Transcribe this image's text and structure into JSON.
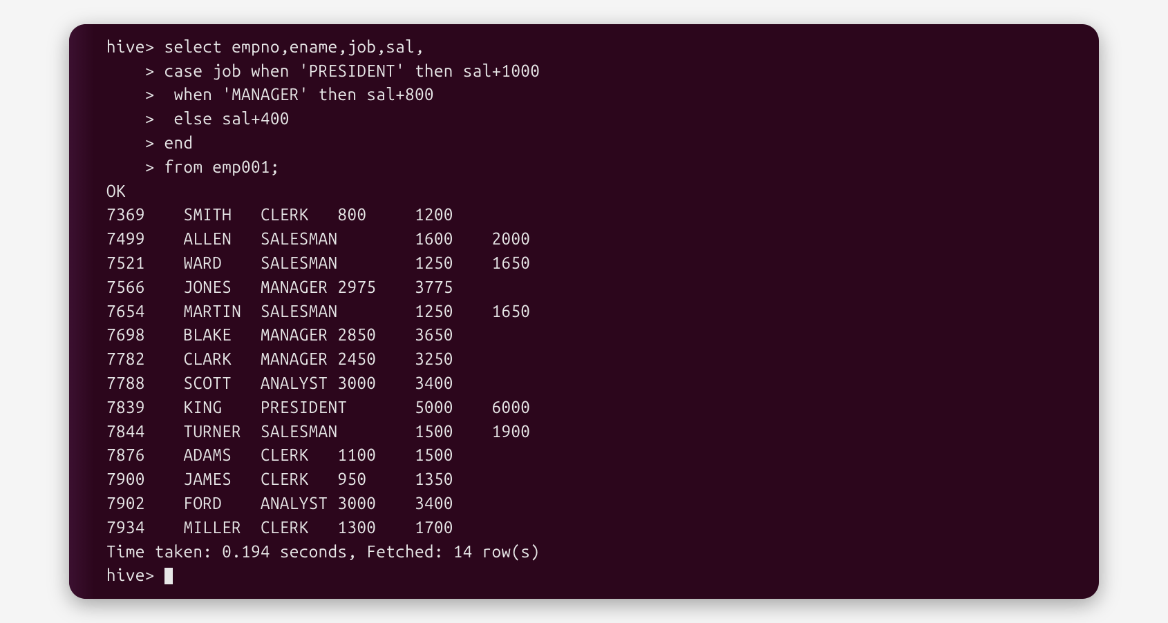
{
  "terminal": {
    "prompt": "hive>",
    "continuation_prompt": "    >",
    "query_lines": [
      "hive> select empno,ename,job,sal,",
      "    > case job when 'PRESIDENT' then sal+1000",
      "    >  when 'MANAGER' then sal+800",
      "    >  else sal+400",
      "    > end",
      "    > from emp001;"
    ],
    "status_ok": "OK",
    "results": [
      {
        "empno": "7369",
        "ename": "SMITH",
        "job": "CLERK",
        "sal": "800",
        "adjusted": "1200"
      },
      {
        "empno": "7499",
        "ename": "ALLEN",
        "job": "SALESMAN",
        "sal": "1600",
        "adjusted": "2000"
      },
      {
        "empno": "7521",
        "ename": "WARD",
        "job": "SALESMAN",
        "sal": "1250",
        "adjusted": "1650"
      },
      {
        "empno": "7566",
        "ename": "JONES",
        "job": "MANAGER",
        "sal": "2975",
        "adjusted": "3775"
      },
      {
        "empno": "7654",
        "ename": "MARTIN",
        "job": "SALESMAN",
        "sal": "1250",
        "adjusted": "1650"
      },
      {
        "empno": "7698",
        "ename": "BLAKE",
        "job": "MANAGER",
        "sal": "2850",
        "adjusted": "3650"
      },
      {
        "empno": "7782",
        "ename": "CLARK",
        "job": "MANAGER",
        "sal": "2450",
        "adjusted": "3250"
      },
      {
        "empno": "7788",
        "ename": "SCOTT",
        "job": "ANALYST",
        "sal": "3000",
        "adjusted": "3400"
      },
      {
        "empno": "7839",
        "ename": "KING",
        "job": "PRESIDENT",
        "sal": "5000",
        "adjusted": "6000"
      },
      {
        "empno": "7844",
        "ename": "TURNER",
        "job": "SALESMAN",
        "sal": "1500",
        "adjusted": "1900"
      },
      {
        "empno": "7876",
        "ename": "ADAMS",
        "job": "CLERK",
        "sal": "1100",
        "adjusted": "1500"
      },
      {
        "empno": "7900",
        "ename": "JAMES",
        "job": "CLERK",
        "sal": "950",
        "adjusted": "1350"
      },
      {
        "empno": "7902",
        "ename": "FORD",
        "job": "ANALYST",
        "sal": "3000",
        "adjusted": "3400"
      },
      {
        "empno": "7934",
        "ename": "MILLER",
        "job": "CLERK",
        "sal": "1300",
        "adjusted": "1700"
      }
    ],
    "time_summary": "Time taken: 0.194 seconds, Fetched: 14 row(s)",
    "final_prompt": "hive> "
  },
  "render": {
    "result_lines": [
      "7369    SMITH   CLERK   800     1200",
      "7499    ALLEN   SALESMAN        1600    2000",
      "7521    WARD    SALESMAN        1250    1650",
      "7566    JONES   MANAGER 2975    3775",
      "7654    MARTIN  SALESMAN        1250    1650",
      "7698    BLAKE   MANAGER 2850    3650",
      "7782    CLARK   MANAGER 2450    3250",
      "7788    SCOTT   ANALYST 3000    3400",
      "7839    KING    PRESIDENT       5000    6000",
      "7844    TURNER  SALESMAN        1500    1900",
      "7876    ADAMS   CLERK   1100    1500",
      "7900    JAMES   CLERK   950     1350",
      "7902    FORD    ANALYST 3000    3400",
      "7934    MILLER  CLERK   1300    1700"
    ]
  }
}
